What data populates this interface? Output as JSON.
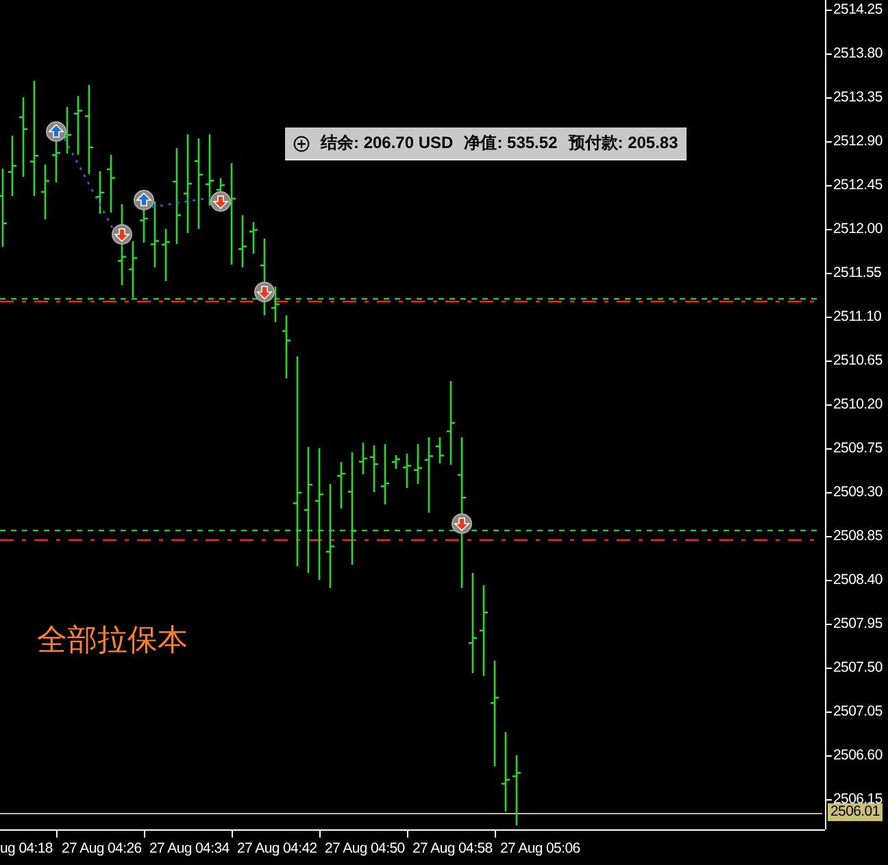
{
  "info_panel": {
    "items": [
      "结余: 206.70 USD",
      "净值: 535.52",
      "预付款: 205.83"
    ]
  },
  "annotation": "全部拉保本",
  "price_axis": {
    "labels": [
      "2514.25",
      "2513.80",
      "2513.35",
      "2512.90",
      "2512.45",
      "2512.00",
      "2511.55",
      "2511.10",
      "2510.65",
      "2510.20",
      "2509.75",
      "2509.30",
      "2508.85",
      "2508.40",
      "2507.95",
      "2507.50",
      "2507.05",
      "2506.60",
      "2506.15"
    ],
    "current_price": "2506.01"
  },
  "time_axis": {
    "labels": [
      "ug 04:18",
      "27 Aug 04:26",
      "27 Aug 04:34",
      "27 Aug 04:42",
      "27 Aug 04:50",
      "27 Aug 04:58",
      "27 Aug 05:06"
    ]
  }
}
